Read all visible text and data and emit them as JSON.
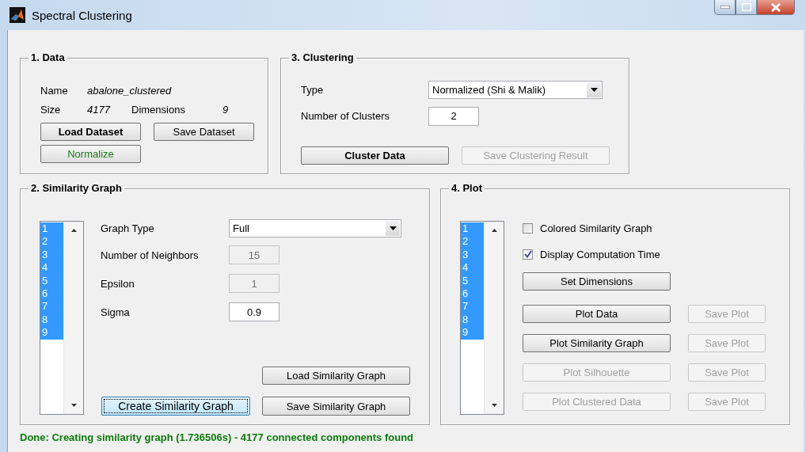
{
  "window": {
    "title": "Spectral Clustering"
  },
  "data": {
    "title": "1. Data",
    "name_label": "Name",
    "name": "abalone_clustered",
    "size_label": "Size",
    "size": "4177",
    "dimensions_label": "Dimensions",
    "dimensions": "9",
    "buttons": [
      {
        "label": "Load Dataset",
        "kind": "bold",
        "disabled": false
      },
      {
        "label": "Save Dataset",
        "kind": "plain",
        "disabled": false
      },
      {
        "label": "Normalize",
        "kind": "green",
        "disabled": false
      }
    ]
  },
  "clustering": {
    "title": "3. Clustering",
    "type_label": "Type",
    "type": "Normalized (Shi & Malik)",
    "clusters_label": "Number of Clusters",
    "clusters": "2",
    "buttons": [
      {
        "label": "Cluster Data",
        "kind": "bold",
        "disabled": false
      },
      {
        "label": "Save Clustering Result",
        "kind": "plain",
        "disabled": true
      }
    ]
  },
  "similarity": {
    "title": "2. Similarity Graph",
    "list": [
      {
        "label": "1",
        "selected": true
      },
      {
        "label": "2",
        "selected": true
      },
      {
        "label": "3",
        "selected": true
      },
      {
        "label": "4",
        "selected": true
      },
      {
        "label": "5",
        "selected": true
      },
      {
        "label": "6",
        "selected": true
      },
      {
        "label": "7",
        "selected": true
      },
      {
        "label": "8",
        "selected": true
      },
      {
        "label": "9",
        "selected": true
      }
    ],
    "graph_type_label": "Graph Type",
    "graph_type": "Full",
    "fields": [
      {
        "label": "Number of Neighbors",
        "value": "15",
        "disabled": true
      },
      {
        "label": "Epsilon",
        "value": "1",
        "disabled": true
      },
      {
        "label": "Sigma",
        "value": "0.9",
        "disabled": false
      }
    ],
    "load_button": {
      "label": "Load Similarity Graph",
      "disabled": false
    },
    "create_button": {
      "label": "Create Similarity Graph",
      "kind": "large",
      "disabled": false,
      "focused": true
    },
    "save_button": {
      "label": "Save Similarity Graph",
      "disabled": false
    }
  },
  "plot": {
    "title": "4. Plot",
    "list": [
      {
        "label": "1",
        "selected": true
      },
      {
        "label": "2",
        "selected": true
      },
      {
        "label": "3",
        "selected": true
      },
      {
        "label": "4",
        "selected": true
      },
      {
        "label": "5",
        "selected": true
      },
      {
        "label": "6",
        "selected": true
      },
      {
        "label": "7",
        "selected": true
      },
      {
        "label": "8",
        "selected": true
      },
      {
        "label": "9",
        "selected": true
      }
    ],
    "checkboxes": [
      {
        "label": "Colored Similarity Graph",
        "checked": false
      },
      {
        "label": "Display Computation Time",
        "checked": true
      }
    ],
    "set_dimensions": {
      "label": "Set Dimensions",
      "disabled": false
    },
    "rows": [
      {
        "plot": {
          "label": "Plot Data",
          "disabled": false
        },
        "save": {
          "label": "Save Plot",
          "disabled": true
        }
      },
      {
        "plot": {
          "label": "Plot Similarity Graph",
          "disabled": false
        },
        "save": {
          "label": "Save Plot",
          "disabled": true
        }
      },
      {
        "plot": {
          "label": "Plot Silhouette",
          "disabled": true
        },
        "save": {
          "label": "Save Plot",
          "disabled": true
        }
      },
      {
        "plot": {
          "label": "Plot Clustered Data",
          "disabled": true
        },
        "save": {
          "label": "Save Plot",
          "disabled": true
        }
      }
    ]
  },
  "status": "Done: Creating similarity graph (1.736506s) - 4177 connected components found"
}
